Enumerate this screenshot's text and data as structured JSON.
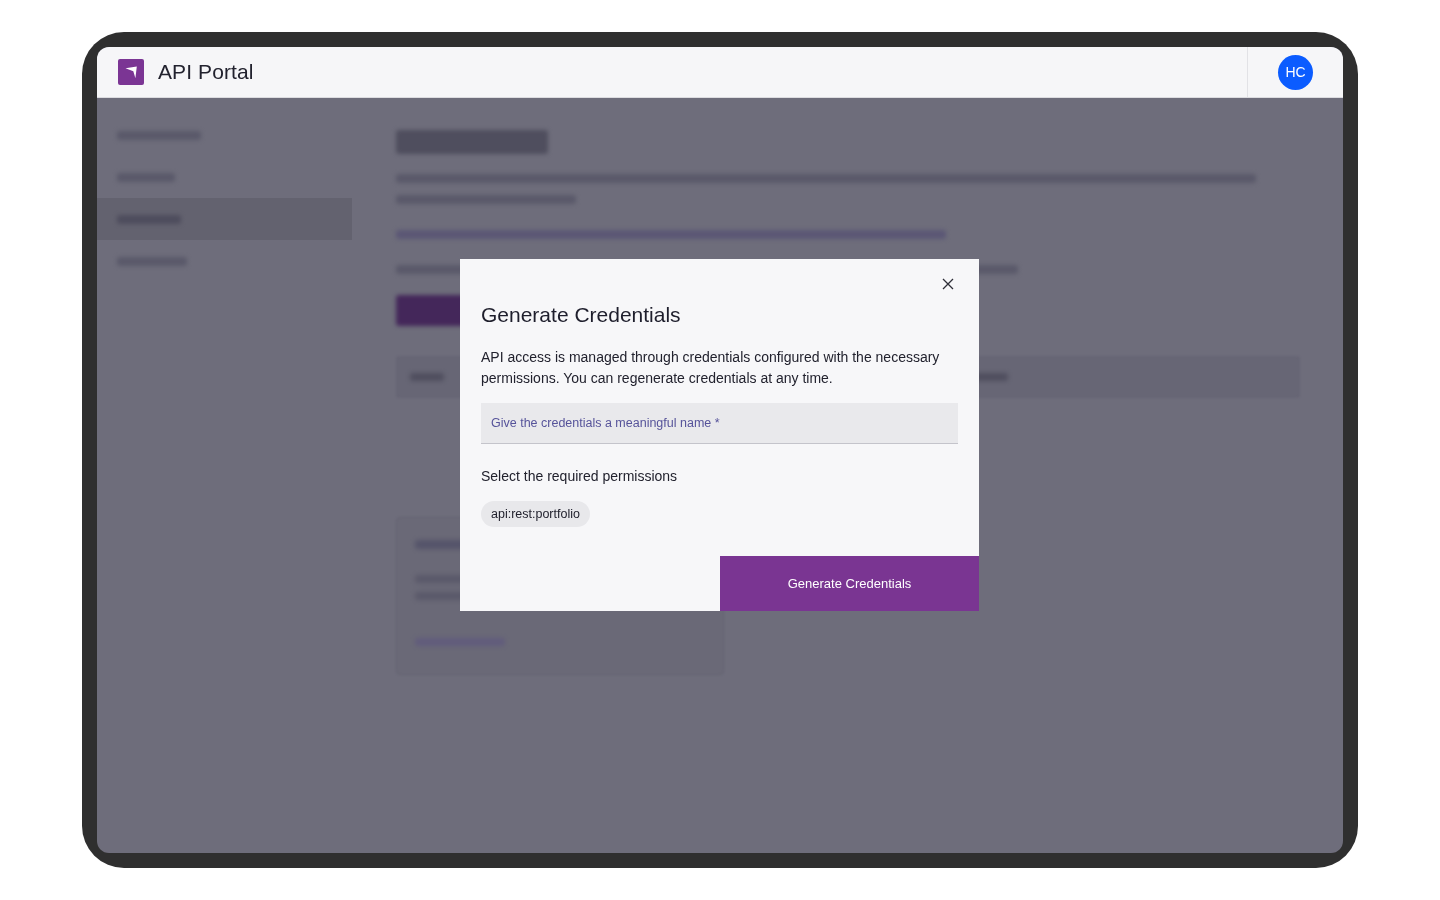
{
  "header": {
    "title": "API Portal",
    "avatar": {
      "initials": "HC"
    }
  },
  "dialog": {
    "title": "Generate Credentials",
    "description": "API access is managed through credentials configured with the necessary permissions. You can regenerate credentials at any time.",
    "name_field": {
      "placeholder": "Give the credentials a meaningful name *"
    },
    "permissions_label": "Select the required permissions",
    "permissions": [
      {
        "label": "api:rest:portfolio",
        "selected": false
      }
    ],
    "submit_button": "Generate Credentials"
  }
}
